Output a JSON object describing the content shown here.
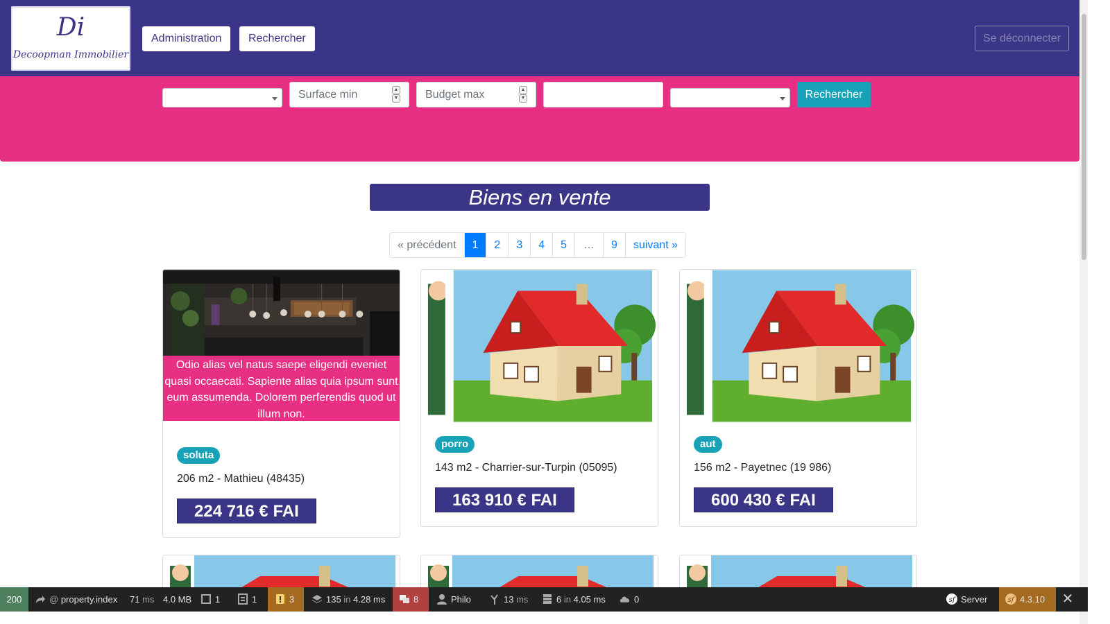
{
  "navbar": {
    "logo_monogram": "Di",
    "logo_text": "Decoopman Immobilier",
    "admin_label": "Administration",
    "search_label": "Rechercher",
    "logout_label": "Se déconnecter",
    "bg_color": "#3b3588"
  },
  "search": {
    "surface_placeholder": "Surface min",
    "budget_placeholder": "Budget max",
    "submit_label": "Rechercher",
    "bg_color": "#e72f84",
    "button_color": "#17a2b8"
  },
  "main": {
    "title": "Biens en vente"
  },
  "pagination": {
    "prev": "« précédent",
    "pages": [
      "1",
      "2",
      "3",
      "4",
      "5",
      "…",
      "9"
    ],
    "active": "1",
    "next": "suivant »"
  },
  "cards": [
    {
      "image": "kitchen-interior",
      "description": "Odio alias vel natus saepe eligendi eveniet quasi occaecati. Sapiente alias quia ipsum sunt eum assumenda. Dolorem perferendis quod ut illum non.",
      "tag": "soluta",
      "info": "206 m2 - Mathieu (48435)",
      "price": "224 716 € FAI"
    },
    {
      "image": "house-illustration",
      "tag": "porro",
      "info": "143 m2 - Charrier-sur-Turpin (05095)",
      "price": "163 910 € FAI"
    },
    {
      "image": "house-illustration",
      "tag": "aut",
      "info": "156 m2 - Payetnec (19 986)",
      "price": "600 430 € FAI"
    }
  ],
  "debug_toolbar": {
    "status": "200",
    "route": "property.index",
    "route_prefix": "@",
    "time": "71",
    "time_unit": "ms",
    "memory": "4.0 MB",
    "forms": "1",
    "logs": "1",
    "warnings": "3",
    "cache_calls": "135",
    "cache_in": "in",
    "cache_time": "4.28 ms",
    "translations": "8",
    "user": "Philo",
    "twig_time": "13",
    "twig_unit": "ms",
    "db_queries": "6",
    "db_in": "in",
    "db_time": "4.05 ms",
    "uploads": "0",
    "server_label": "Server",
    "version": "4.3.10"
  }
}
